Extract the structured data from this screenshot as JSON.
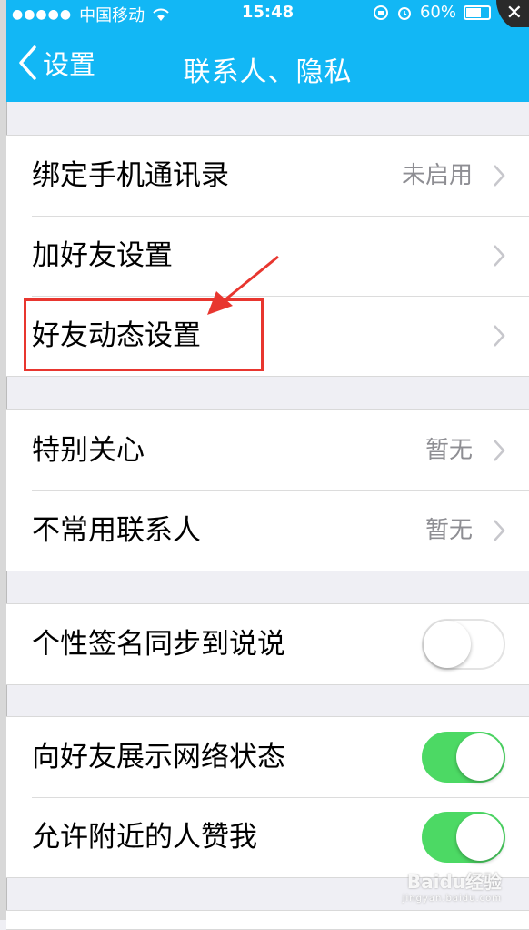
{
  "status_bar": {
    "carrier": "中国移动",
    "time": "15:48",
    "battery": "60%"
  },
  "nav": {
    "back_label": "设置",
    "title": "联系人、隐私"
  },
  "groups": [
    [
      {
        "label": "绑定手机通讯录",
        "value": "未启用"
      },
      {
        "label": "加好友设置",
        "value": ""
      },
      {
        "label": "好友动态设置",
        "value": ""
      }
    ],
    [
      {
        "label": "特别关心",
        "value": "暂无"
      },
      {
        "label": "不常用联系人",
        "value": "暂无"
      }
    ],
    [
      {
        "label": "个性签名同步到说说",
        "toggle": false
      }
    ],
    [
      {
        "label": "向好友展示网络状态",
        "toggle": true
      },
      {
        "label": "允许附近的人赞我",
        "toggle": true
      }
    ]
  ],
  "colors": {
    "accent": "#12b7f5",
    "toggle_on": "#4cd964",
    "highlight": "#e8362f"
  },
  "watermark": {
    "brand": "Baidu经验",
    "url": "jingyan.baidu.com"
  }
}
